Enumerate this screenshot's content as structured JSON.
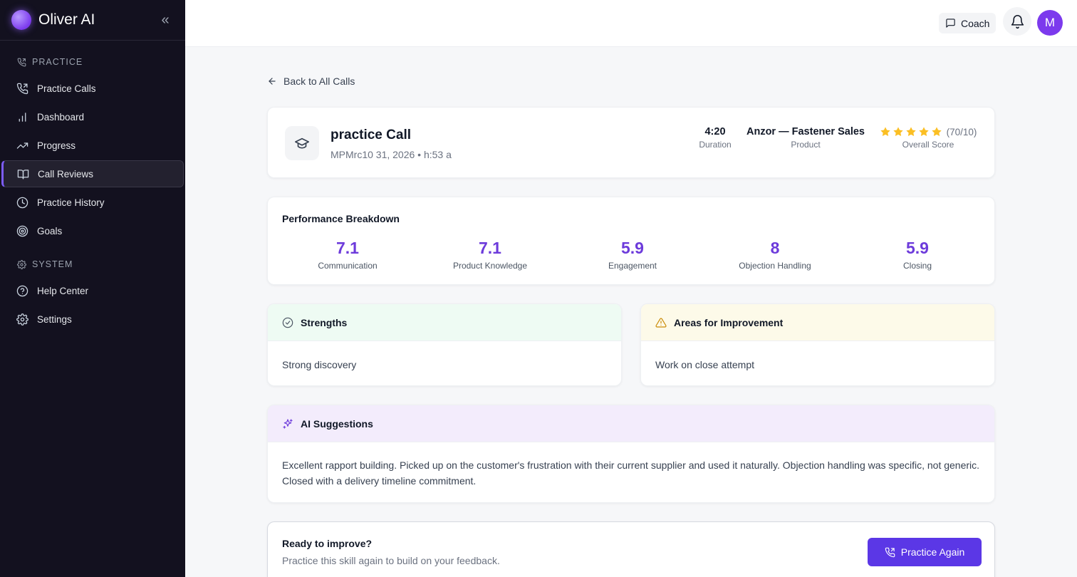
{
  "app": {
    "name": "Oliver AI"
  },
  "sidebar": {
    "sections": [
      {
        "label": "PRACTICE",
        "icon": "phone-icon"
      },
      {
        "label": "SYSTEM",
        "icon": "gear-icon"
      }
    ],
    "practice_items": [
      {
        "label": "Practice Calls",
        "icon": "phone-icon",
        "active": false
      },
      {
        "label": "Dashboard",
        "icon": "bar-chart-icon",
        "active": false
      },
      {
        "label": "Progress",
        "icon": "trending-up-icon",
        "active": false
      },
      {
        "label": "Call Reviews",
        "icon": "book-open-icon",
        "active": true
      },
      {
        "label": "Practice History",
        "icon": "clock-icon",
        "active": false
      },
      {
        "label": "Goals",
        "icon": "target-icon",
        "active": false
      }
    ],
    "system_items": [
      {
        "label": "Help Center",
        "icon": "help-circle-icon"
      },
      {
        "label": "Settings",
        "icon": "gear-icon"
      }
    ]
  },
  "topbar": {
    "coach_label": "Coach",
    "avatar_initial": "M"
  },
  "main": {
    "back_label": "Back to All Calls",
    "call": {
      "title": "practice Call",
      "subtitle": "MPMrc10 31, 2026 • h:53 a",
      "duration_value": "4:20",
      "duration_label": "Duration",
      "product_value": "Anzor — Fastener Sales",
      "product_label": "Product",
      "score_text": "(70/10)",
      "score_label": "Overall Score",
      "stars_filled": 5,
      "stars_total": 5
    },
    "performance": {
      "title": "Performance Breakdown",
      "items": [
        {
          "value": "7.1",
          "label": "Communication"
        },
        {
          "value": "7.1",
          "label": "Product Knowledge"
        },
        {
          "value": "5.9",
          "label": "Engagement"
        },
        {
          "value": "8",
          "label": "Objection Handling"
        },
        {
          "value": "5.9",
          "label": "Closing"
        }
      ]
    },
    "strengths": {
      "title": "Strengths",
      "body": "Strong discovery"
    },
    "improvement": {
      "title": "Areas for Improvement",
      "body": "Work on close attempt"
    },
    "ai": {
      "title": "AI Suggestions",
      "body": "Excellent rapport building. Picked up on the customer's frustration with their current supplier and used it naturally. Objection handling was specific, not generic. Closed with a delivery timeline commitment."
    },
    "ready": {
      "title": "Ready to improve?",
      "subtitle": "Practice this skill again to build on your feedback.",
      "button_label": "Practice Again"
    }
  },
  "colors": {
    "sidebar_bg": "#13111f",
    "accent": "#6d3bdb",
    "primary_button": "#5b37e6",
    "star": "#fbbf24",
    "strengths_bg": "#eefbf3",
    "improvement_bg": "#fdfae9",
    "ai_bg": "#f3ecfc"
  }
}
